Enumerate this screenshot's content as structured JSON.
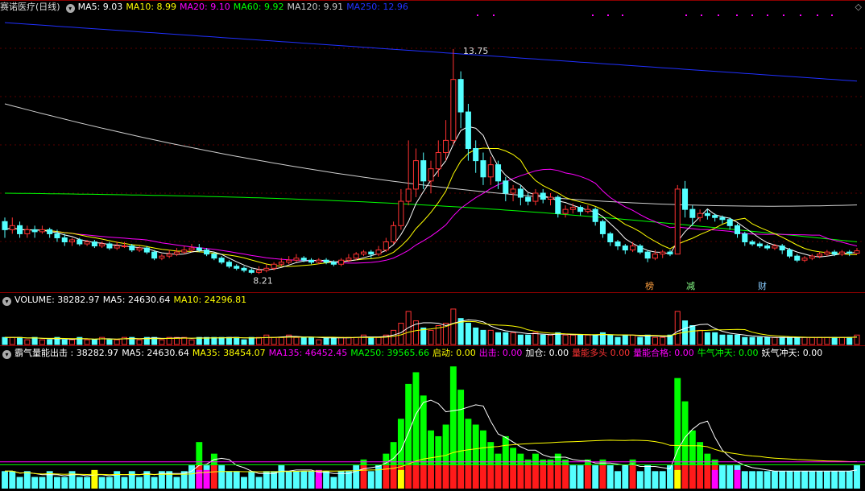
{
  "header": {
    "stock": "赛诺医疗(日线)",
    "ma5": "MA5: 9.03",
    "ma10": "MA10: 8.99",
    "ma20": "MA20: 9.10",
    "ma60": "MA60: 9.92",
    "ma120": "MA120: 9.91",
    "ma250": "MA250: 12.96"
  },
  "volume_header": {
    "label": "VOLUME: 38282.97",
    "ma5": "MA5: 24630.64",
    "ma10": "MA10: 24296.81"
  },
  "indicator_header": {
    "label": "霸气量能出击 : 38282.97",
    "ma5": "MA5: 24630.64",
    "ma35": "MA35: 38454.07",
    "ma135": "MA135: 46452.45",
    "ma250": "MA250: 39565.66",
    "qidong": "启动: 0.00",
    "chuji": "出击: 0.00",
    "jiacang": "加仓: 0.00",
    "liangneng_duotou": "量能多头  0.00",
    "liangneng_hege": "量能合格: 0.00",
    "niuqi": "牛气冲天: 0.00",
    "yaoqi": "妖气冲天: 0.00"
  },
  "signals": {
    "bang": "榜",
    "jian": "减",
    "cai": "财"
  },
  "colors": {
    "up": "#ff3232",
    "down": "#54ffff",
    "ma5": "#ffffff",
    "ma10": "#ffff00",
    "ma20": "#ff00ff",
    "ma60": "#00ff00",
    "ma120": "#cfcfcf",
    "ma250": "#2030ff",
    "green": "#00ff00",
    "magenta": "#ff00ff",
    "yellow": "#ffff00"
  },
  "chart_data": {
    "type": "candlestick",
    "high_label": "13.75",
    "low_label": "8.21",
    "ylim": [
      7.9,
      14.6
    ],
    "candles": [
      [
        9.5,
        9.3,
        9.6,
        9.1
      ],
      [
        9.3,
        9.4,
        9.6,
        9.2
      ],
      [
        9.4,
        9.2,
        9.5,
        9.1
      ],
      [
        9.2,
        9.3,
        9.4,
        9.1
      ],
      [
        9.3,
        9.25,
        9.4,
        9.1
      ],
      [
        9.25,
        9.3,
        9.4,
        9.2
      ],
      [
        9.3,
        9.2,
        9.35,
        9.1
      ],
      [
        9.2,
        9.1,
        9.3,
        9.0
      ],
      [
        9.1,
        9.0,
        9.2,
        8.9
      ],
      [
        9.0,
        9.05,
        9.1,
        8.9
      ],
      [
        9.05,
        8.95,
        9.1,
        8.9
      ],
      [
        8.95,
        9.0,
        9.05,
        8.9
      ],
      [
        9.0,
        8.9,
        9.05,
        8.85
      ],
      [
        8.9,
        8.95,
        9.0,
        8.85
      ],
      [
        8.95,
        8.85,
        9.0,
        8.8
      ],
      [
        8.85,
        8.9,
        9.0,
        8.8
      ],
      [
        8.9,
        8.9,
        9.0,
        8.85
      ],
      [
        8.9,
        8.8,
        8.95,
        8.75
      ],
      [
        8.8,
        8.85,
        8.9,
        8.75
      ],
      [
        8.85,
        8.75,
        8.9,
        8.7
      ],
      [
        8.75,
        8.6,
        8.8,
        8.55
      ],
      [
        8.6,
        8.65,
        8.7,
        8.55
      ],
      [
        8.65,
        8.7,
        8.8,
        8.6
      ],
      [
        8.7,
        8.75,
        8.85,
        8.65
      ],
      [
        8.75,
        8.8,
        8.9,
        8.7
      ],
      [
        8.8,
        8.85,
        8.95,
        8.75
      ],
      [
        8.85,
        8.8,
        8.95,
        8.75
      ],
      [
        8.8,
        8.7,
        8.85,
        8.65
      ],
      [
        8.7,
        8.6,
        8.75,
        8.55
      ],
      [
        8.6,
        8.5,
        8.65,
        8.45
      ],
      [
        8.5,
        8.4,
        8.55,
        8.35
      ],
      [
        8.4,
        8.35,
        8.45,
        8.3
      ],
      [
        8.35,
        8.3,
        8.4,
        8.25
      ],
      [
        8.3,
        8.25,
        8.35,
        8.21
      ],
      [
        8.25,
        8.3,
        8.4,
        8.21
      ],
      [
        8.3,
        8.35,
        8.45,
        8.25
      ],
      [
        8.35,
        8.45,
        8.5,
        8.3
      ],
      [
        8.45,
        8.5,
        8.6,
        8.4
      ],
      [
        8.5,
        8.55,
        8.65,
        8.45
      ],
      [
        8.55,
        8.6,
        8.7,
        8.5
      ],
      [
        8.6,
        8.55,
        8.65,
        8.5
      ],
      [
        8.55,
        8.5,
        8.6,
        8.45
      ],
      [
        8.5,
        8.55,
        8.6,
        8.45
      ],
      [
        8.55,
        8.5,
        8.6,
        8.45
      ],
      [
        8.5,
        8.45,
        8.55,
        8.4
      ],
      [
        8.45,
        8.55,
        8.6,
        8.4
      ],
      [
        8.55,
        8.6,
        8.7,
        8.5
      ],
      [
        8.6,
        8.7,
        8.75,
        8.55
      ],
      [
        8.7,
        8.75,
        8.8,
        8.65
      ],
      [
        8.75,
        8.7,
        8.8,
        8.6
      ],
      [
        8.7,
        8.8,
        8.9,
        8.65
      ],
      [
        8.8,
        9.0,
        9.1,
        8.75
      ],
      [
        9.0,
        9.4,
        9.5,
        8.95
      ],
      [
        9.4,
        10.0,
        10.3,
        9.3
      ],
      [
        10.0,
        10.3,
        11.5,
        9.9
      ],
      [
        10.3,
        11.0,
        11.3,
        10.1
      ],
      [
        11.0,
        10.5,
        11.2,
        10.3
      ],
      [
        10.5,
        10.8,
        11.0,
        10.2
      ],
      [
        10.8,
        11.2,
        11.5,
        10.6
      ],
      [
        11.2,
        11.5,
        12.0,
        11.0
      ],
      [
        11.5,
        13.0,
        13.75,
        11.4
      ],
      [
        13.0,
        12.2,
        13.2,
        11.8
      ],
      [
        12.2,
        11.3,
        12.4,
        11.0
      ],
      [
        11.3,
        11.0,
        11.5,
        10.7
      ],
      [
        11.0,
        10.6,
        11.2,
        10.4
      ],
      [
        10.6,
        10.9,
        11.1,
        10.4
      ],
      [
        10.9,
        10.5,
        11.0,
        10.3
      ],
      [
        10.5,
        10.2,
        10.6,
        10.0
      ],
      [
        10.2,
        10.3,
        10.4,
        10.0
      ],
      [
        10.3,
        10.1,
        10.4,
        9.9
      ],
      [
        10.1,
        10.0,
        10.2,
        9.9
      ],
      [
        10.0,
        10.2,
        10.3,
        9.9
      ],
      [
        10.2,
        10.05,
        10.3,
        9.95
      ],
      [
        10.05,
        10.1,
        10.2,
        9.9
      ],
      [
        10.1,
        9.7,
        10.15,
        9.6
      ],
      [
        9.7,
        9.8,
        9.9,
        9.6
      ],
      [
        9.8,
        9.85,
        9.95,
        9.7
      ],
      [
        9.85,
        9.75,
        9.9,
        9.65
      ],
      [
        9.75,
        9.8,
        9.9,
        9.7
      ],
      [
        9.8,
        9.5,
        9.85,
        9.4
      ],
      [
        9.5,
        9.2,
        9.55,
        9.1
      ],
      [
        9.2,
        9.0,
        9.25,
        8.9
      ],
      [
        9.0,
        8.9,
        9.05,
        8.8
      ],
      [
        8.9,
        8.8,
        8.95,
        8.7
      ],
      [
        8.8,
        8.9,
        9.0,
        8.75
      ],
      [
        8.9,
        8.75,
        8.95,
        8.7
      ],
      [
        8.75,
        8.6,
        8.8,
        8.5
      ],
      [
        8.6,
        8.7,
        8.8,
        8.55
      ],
      [
        8.7,
        8.75,
        8.8,
        8.6
      ],
      [
        8.75,
        8.7,
        8.8,
        8.65
      ],
      [
        8.7,
        10.3,
        10.4,
        8.7
      ],
      [
        10.3,
        9.8,
        10.5,
        9.6
      ],
      [
        9.8,
        9.6,
        9.9,
        9.4
      ],
      [
        9.6,
        9.7,
        9.8,
        9.5
      ],
      [
        9.7,
        9.65,
        9.8,
        9.55
      ],
      [
        9.65,
        9.6,
        9.7,
        9.5
      ],
      [
        9.6,
        9.55,
        9.65,
        9.45
      ],
      [
        9.55,
        9.4,
        9.6,
        9.3
      ],
      [
        9.4,
        9.2,
        9.45,
        9.1
      ],
      [
        9.2,
        9.0,
        9.25,
        8.9
      ],
      [
        9.0,
        8.95,
        9.05,
        8.9
      ],
      [
        8.95,
        8.9,
        9.0,
        8.85
      ],
      [
        8.9,
        8.85,
        8.95,
        8.8
      ],
      [
        8.85,
        8.9,
        8.95,
        8.8
      ],
      [
        8.9,
        8.8,
        8.95,
        8.7
      ],
      [
        8.8,
        8.65,
        8.85,
        8.6
      ],
      [
        8.65,
        8.55,
        8.7,
        8.5
      ],
      [
        8.55,
        8.6,
        8.65,
        8.5
      ],
      [
        8.6,
        8.65,
        8.7,
        8.55
      ],
      [
        8.65,
        8.7,
        8.75,
        8.6
      ],
      [
        8.7,
        8.75,
        8.8,
        8.65
      ],
      [
        8.75,
        8.7,
        8.8,
        8.65
      ],
      [
        8.7,
        8.75,
        8.8,
        8.65
      ],
      [
        8.75,
        8.72,
        8.8,
        8.65
      ],
      [
        8.72,
        8.78,
        8.85,
        8.7
      ]
    ],
    "ma250_start": 14.4,
    "ma250_end": 12.96,
    "ma120_start": 12.4,
    "ma60_start": 10.2,
    "volume": [
      3,
      3,
      3,
      2,
      3,
      2,
      2,
      3,
      2,
      2,
      3,
      2,
      2,
      3,
      2,
      2,
      3,
      3,
      2,
      3,
      3,
      2,
      3,
      3,
      3,
      2,
      3,
      3,
      3,
      3,
      3,
      3,
      2,
      3,
      3,
      4,
      3,
      3,
      4,
      3,
      3,
      3,
      2,
      3,
      3,
      3,
      3,
      3,
      4,
      3,
      3,
      4,
      6,
      9,
      14,
      10,
      7,
      6,
      8,
      9,
      15,
      11,
      9,
      7,
      6,
      6,
      5,
      5,
      5,
      4,
      4,
      5,
      4,
      4,
      5,
      4,
      4,
      4,
      4,
      4,
      5,
      4,
      3,
      4,
      4,
      3,
      4,
      3,
      3,
      4,
      14,
      10,
      8,
      6,
      5,
      5,
      4,
      4,
      4,
      3,
      3,
      3,
      3,
      3,
      3,
      3,
      3,
      3,
      3,
      3,
      3,
      3,
      3,
      3,
      4
    ],
    "volume_max": 16,
    "indicator": [
      3,
      3,
      2,
      3,
      2,
      2,
      3,
      2,
      2,
      3,
      2,
      2,
      3,
      2,
      2,
      3,
      2,
      3,
      2,
      3,
      2,
      3,
      3,
      2,
      3,
      4,
      8,
      4,
      6,
      4,
      3,
      3,
      2,
      3,
      2,
      3,
      3,
      4,
      3,
      3,
      3,
      3,
      2,
      3,
      2,
      3,
      3,
      4,
      5,
      3,
      4,
      6,
      8,
      12,
      18,
      20,
      16,
      10,
      9,
      11,
      21,
      17,
      12,
      11,
      10,
      8,
      6,
      9,
      7,
      6,
      5,
      6,
      5,
      5,
      6,
      5,
      4,
      4,
      5,
      4,
      5,
      4,
      3,
      4,
      5,
      3,
      4,
      3,
      3,
      4,
      19,
      15,
      10,
      8,
      6,
      5,
      4,
      4,
      4,
      3,
      3,
      3,
      3,
      3,
      3,
      3,
      3,
      3,
      3,
      3,
      3,
      3,
      3,
      3,
      4
    ],
    "indicator_max": 22
  }
}
